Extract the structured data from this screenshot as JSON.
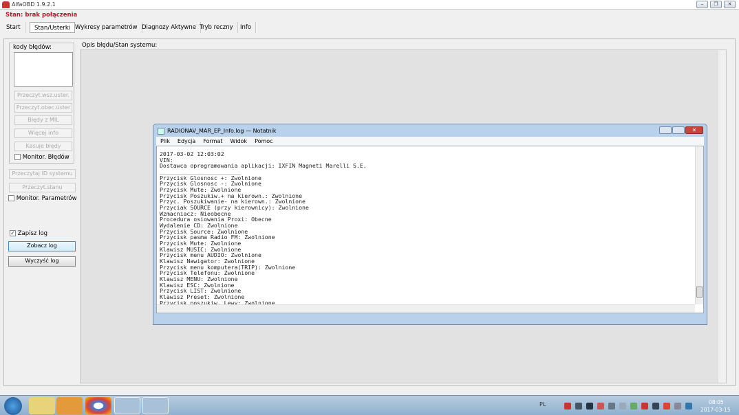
{
  "window": {
    "title": "AlfaOBD 1.9.2.1",
    "minimize": "–",
    "maximize": "❐",
    "close": "✕"
  },
  "status": "Stan: brak połączenia",
  "tabs": [
    "Start",
    "Stan/Usterki",
    "Wykresy parametrów",
    "Diagnozy Aktywne",
    "Tryb reczny",
    "Info"
  ],
  "left": {
    "codes_label": "kody błędów:",
    "buttons": [
      "Przeczyt.wsz.uster.",
      "Przeczyt.obec.uster",
      "Błędy z MIL",
      "Więcej info",
      "Kasuje błędy"
    ],
    "monitor_errors": "Monitor. Błędów",
    "read_id": "Przeczytaj ID systemu",
    "read_state": "Przeczyt.stanu",
    "monitor_params": "Monitor. Parametrów",
    "save_log": "Zapisz log",
    "save_log_checked": true,
    "view_log": "Zobacz log",
    "clear_log": "Wyczyść log"
  },
  "desc_label": "Opis błędu/Stan systemu:",
  "notepad": {
    "title": "RADIONAV_MAR_EP_Info.log — Notatnik",
    "menu": [
      "Plik",
      "Edycja",
      "Format",
      "Widok",
      "Pomoc"
    ],
    "content": "2017-03-02 12:03:02\nVIN:\nDostawca oprogramowania aplikacji: IXFIN Magneti Marelli S.E.\n________________________\nPrzycisk Glosnosc +: Zwolnione\nPrzycisk Glosnosc -: Zwolnione\nPrzycisk Mute: Zwolnione\nPrzycisk Poszukiw.+ na kierown.: Zwolnione\nPrzyc. Poszukiwanie- na kierown.: Zwolnione\nPrzyciak SOURCE (przy kierownicy): Zwolnione\nWzmacniacz: Nieobecne\nProcedura osiowania Proxi: Obecne\nWydalenie CD: Zwolnione\nPrzycisk Source: Zwolnione\nPrzycisk pasma Radio FM: Zwolnione\nPrzycisk Mute: Zwolnione\nKlawisz MUSIC: Zwolnione\nPrzycisk menu AUDIO: Zwolnione\nKlawisz Nawigator: Zwolnione\nPrzycisk menu komputera(TRIP): Zwolnione\nPrzycisk Telefonu: Zwolnione\nKlawisz MENU: Zwolnione\nKlawisz ESC: Zwolnione\nPrzycisk LIST: Zwolnione\nKlawisz Preset: Zwolnione\nPrzycisk poszukiw. Lewy: Zwolnione"
  },
  "taskbar": {
    "lang": "PL",
    "time": "08:05",
    "date": "2017-03-15"
  }
}
